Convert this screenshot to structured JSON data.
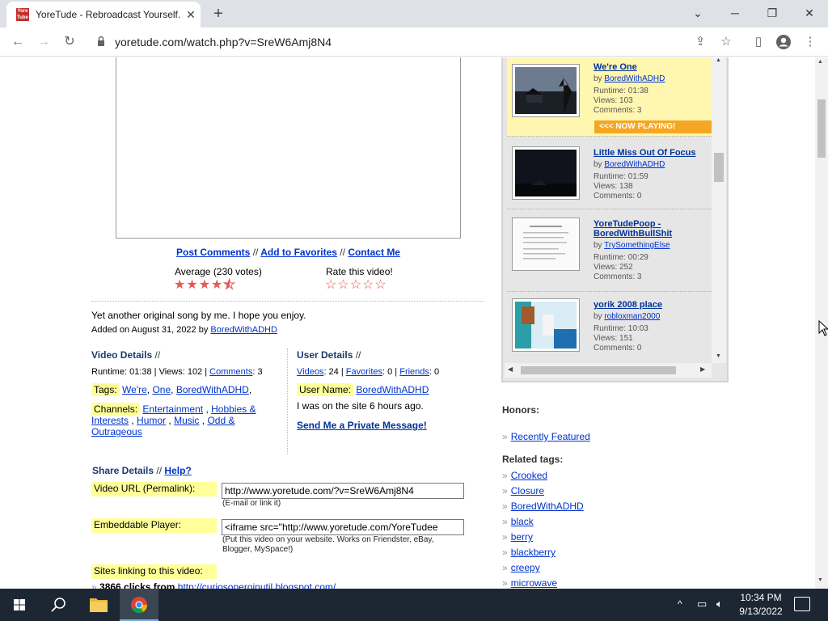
{
  "browser": {
    "tab_title": "YoreTude - Rebroadcast Yourself.",
    "favicon_text": "Yore Tube",
    "url": "yoretude.com/watch.php?v=SreW6Amj8N4"
  },
  "video": {
    "actions": {
      "post_comments": "Post Comments",
      "sep": "//",
      "add_favorites": "Add to Favorites",
      "contact_me": "Contact Me"
    },
    "average_label": "Average (230 votes)",
    "average_rating": 4.5,
    "rate_label": "Rate this video!",
    "description": "Yet another original song by me. I hope you enjoy.",
    "added_prefix": "Added on August 31, 2022 by",
    "added_by": "BoredWithADHD"
  },
  "video_details": {
    "heading": "Video Details",
    "heading_sep": "//",
    "runtime": "Runtime: 01:38 | Views: 102 |",
    "comments_link": "Comments",
    "comments_count": ": 3",
    "tags_label": "Tags:",
    "tags": [
      "We're",
      "One",
      "BoredWithADHD"
    ],
    "channels_label": "Channels:",
    "channels": [
      "Entertainment",
      "Hobbies & Interests",
      "Humor",
      "Music",
      "Odd & Outrageous"
    ]
  },
  "user_details": {
    "heading": "User Details",
    "heading_sep": "//",
    "videos_link": "Videos",
    "videos_count": ": 24 |",
    "favorites_link": "Favorites",
    "favorites_count": ": 0 |",
    "friends_link": "Friends",
    "friends_count": ": 0",
    "username_label": "User Name:",
    "username": "BoredWithADHD",
    "last_seen": "I was on the site 6 hours ago.",
    "private_message": "Send Me a Private Message!"
  },
  "share": {
    "heading": "Share Details",
    "heading_sep": "//",
    "help": "Help?",
    "url_label": "Video URL (Permalink):",
    "url_value": "http://www.yoretude.com/?v=SreW6Amj8N4",
    "url_hint": "(E-mail or link it)",
    "embed_label": "Embeddable Player:",
    "embed_value": "<iframe src=\"http://www.yoretude.com/YoreTudee",
    "embed_hint": "(Put this video on your website. Works on Friendster, eBay, Blogger, MySpace!)",
    "sites_label": "Sites linking to this video:",
    "sites_first_count": "3866 clicks from",
    "sites_first_url": "http://curiosoperoinutil.blogspot.com/"
  },
  "playlist": [
    {
      "title": "We're One",
      "by": "BoredWithADHD",
      "runtime": "Runtime: 01:38",
      "views": "Views: 103",
      "comments": "Comments: 3",
      "now_playing": true
    },
    {
      "title": "Little Miss Out Of Focus",
      "by": "BoredWithADHD",
      "runtime": "Runtime: 01:59",
      "views": "Views: 138",
      "comments": "Comments: 0",
      "now_playing": false
    },
    {
      "title": "YoreTudePoop - BoredWithBullShit",
      "by": "TrySomethingElse",
      "runtime": "Runtime: 00:29",
      "views": "Views: 252",
      "comments": "Comments: 3",
      "now_playing": false
    },
    {
      "title": "yorik 2008 place",
      "by": "robloxman2000",
      "runtime": "Runtime: 10:03",
      "views": "Views: 151",
      "comments": "Comments: 0",
      "now_playing": false
    }
  ],
  "now_playing_label": "<<< NOW PLAYING!",
  "by_prefix": "by",
  "honors": {
    "label": "Honors:",
    "items": [
      "Recently Featured"
    ]
  },
  "related_tags": {
    "label": "Related tags:",
    "items": [
      "Crooked",
      "Closure",
      "BoredWithADHD",
      "black",
      "berry",
      "blackberry",
      "creepy",
      "microwave"
    ]
  },
  "taskbar": {
    "time": "10:34 PM",
    "date": "9/13/2022"
  },
  "colors": {
    "link": "#0033cc",
    "heading": "#1a3a6e",
    "highlight": "#ffff99",
    "now_playing_bg": "#f5a623",
    "now_playing_row": "#fff6b0",
    "star": "#e35b57",
    "taskbar": "#1c2733"
  }
}
